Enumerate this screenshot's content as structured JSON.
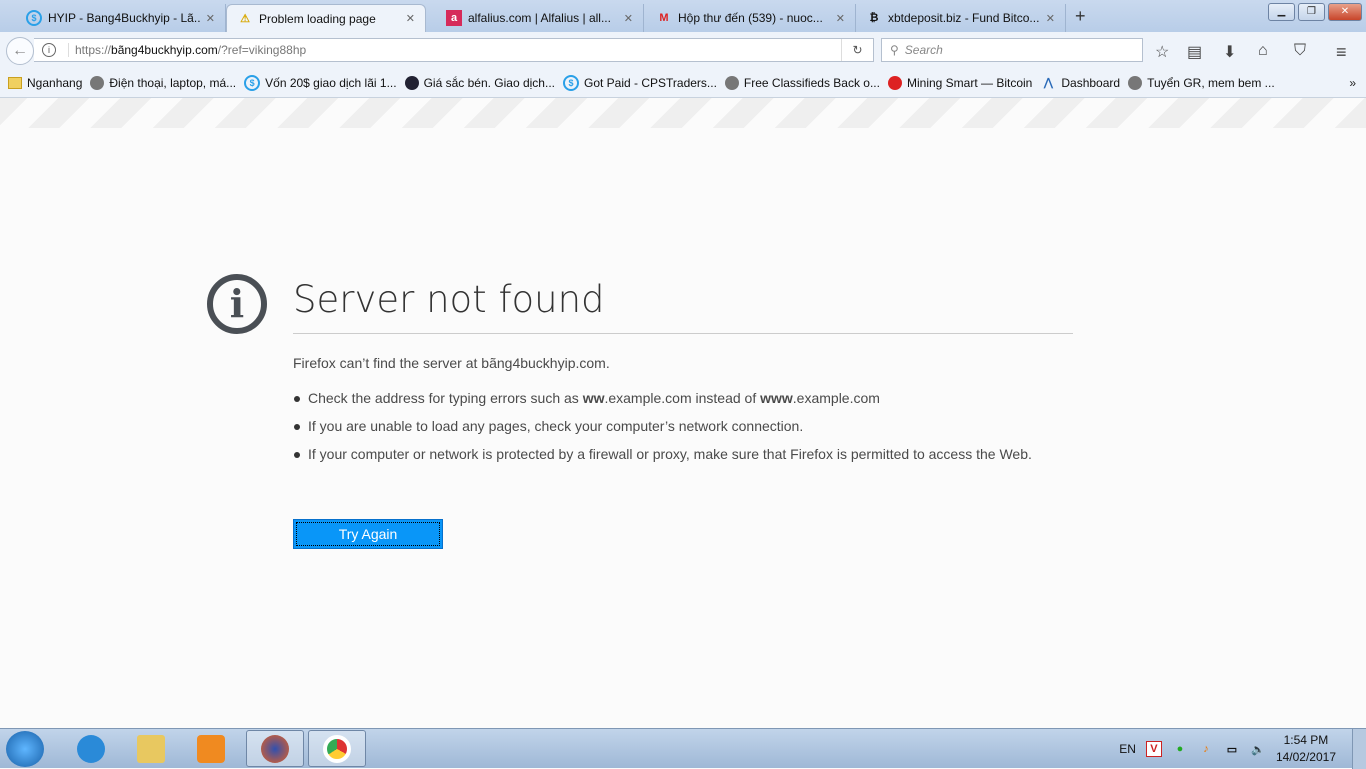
{
  "tabs": [
    {
      "title": "HYIP - Bang4Buckhyip - Lã...",
      "icon": "s-icon"
    },
    {
      "title": "Problem loading page",
      "icon": "warning-icon"
    },
    {
      "title": "alfalius.com | Alfalius | all...",
      "icon": "a-icon"
    },
    {
      "title": "Hộp thư đến (539) - nuoc...",
      "icon": "gmail-icon"
    },
    {
      "title": "xbtdeposit.biz - Fund Bitco...",
      "icon": "bitcoin-icon"
    }
  ],
  "address": {
    "prefix": "https://",
    "domain": "bãng4buckhyip.com",
    "path": "/?ref=viking88hp"
  },
  "search": {
    "placeholder": "Search"
  },
  "bookmarks": [
    "Nganhang",
    "Điện thoại, laptop, má...",
    "Vốn 20$ giao dịch lãi 1...",
    "Giá sắc bén. Giao dịch...",
    "Got Paid - CPSTraders...",
    "Free Classifieds Back o...",
    "Mining Smart — Bitcoin",
    "Dashboard",
    "Tuyển GR, mem bem ..."
  ],
  "bookmarks_overflow": "»",
  "error": {
    "title": "Server not found",
    "desc": "Firefox can’t find the server at bãng4buckhyip.com.",
    "items": {
      "a1": "Check the address for typing errors such as ",
      "a2": "ww",
      ".": "",
      "a3": ".example.com instead of ",
      "a4": "www",
      "a5": ".example.com",
      "b": "If you are unable to load any pages, check your computer’s network connection.",
      "c": "If your computer or network is protected by a firewall or proxy, make sure that Firefox is permitted to access the Web."
    },
    "button": "Try Again"
  },
  "taskbar": {
    "lang": "EN",
    "time": "1:54 PM",
    "date": "14/02/2017"
  }
}
